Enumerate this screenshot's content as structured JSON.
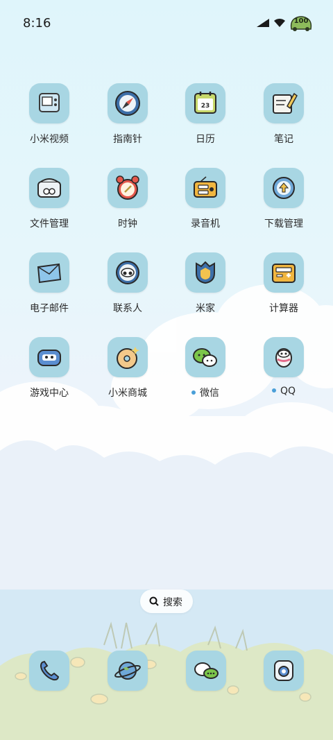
{
  "status_bar": {
    "time": "8:16",
    "battery_level": "100"
  },
  "apps": [
    {
      "label": "小米视频",
      "icon": "video-icon",
      "new": false
    },
    {
      "label": "指南针",
      "icon": "compass-icon",
      "new": false
    },
    {
      "label": "日历",
      "icon": "calendar-icon",
      "day": "23",
      "new": false
    },
    {
      "label": "笔记",
      "icon": "notes-icon",
      "new": false
    },
    {
      "label": "文件管理",
      "icon": "file-manager-icon",
      "new": false
    },
    {
      "label": "时钟",
      "icon": "alarm-clock-icon",
      "new": false
    },
    {
      "label": "录音机",
      "icon": "radio-recorder-icon",
      "new": false
    },
    {
      "label": "下载管理",
      "icon": "download-icon",
      "new": false
    },
    {
      "label": "电子邮件",
      "icon": "envelope-icon",
      "new": false
    },
    {
      "label": "联系人",
      "icon": "contacts-icon",
      "new": false
    },
    {
      "label": "米家",
      "icon": "mijia-icon",
      "new": false
    },
    {
      "label": "计算器",
      "icon": "calculator-icon",
      "new": false
    },
    {
      "label": "游戏中心",
      "icon": "gamepad-icon",
      "new": false
    },
    {
      "label": "小米商城",
      "icon": "donut-icon",
      "new": false
    },
    {
      "label": "微信",
      "icon": "wechat-icon",
      "new": true
    },
    {
      "label": "QQ",
      "icon": "qq-penguin-icon",
      "new": true
    }
  ],
  "search": {
    "label": "搜索"
  },
  "dock": [
    {
      "icon": "phone-icon"
    },
    {
      "icon": "browser-planet-icon"
    },
    {
      "icon": "messages-icon"
    },
    {
      "icon": "camera-icon"
    }
  ],
  "colors": {
    "icon_bg": "#a8d6e3",
    "new_dot": "#4a9fd8"
  }
}
